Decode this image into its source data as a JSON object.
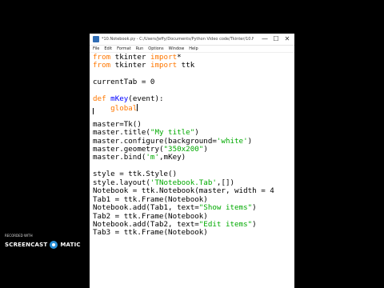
{
  "window": {
    "title": "*10.Notebook.py - C:/Users/Jeffy/Documents/Python Video code/Tkinter/10.Notebook.py (3.6...",
    "controls": {
      "minimize": "—",
      "maximize": "☐",
      "close": "✕"
    }
  },
  "menu": [
    "File",
    "Edit",
    "Format",
    "Run",
    "Options",
    "Window",
    "Help"
  ],
  "code": [
    [
      {
        "t": "from",
        "c": "kw"
      },
      {
        "t": " tkinter "
      },
      {
        "t": "import",
        "c": "kw"
      },
      {
        "t": "*"
      }
    ],
    [
      {
        "t": "from",
        "c": "kw"
      },
      {
        "t": " tkinter "
      },
      {
        "t": "import",
        "c": "kw"
      },
      {
        "t": " ttk"
      }
    ],
    [],
    [
      {
        "t": "currentTab = 0"
      }
    ],
    [],
    [
      {
        "t": "def",
        "c": "kw"
      },
      {
        "t": " "
      },
      {
        "t": "mKey",
        "c": "func"
      },
      {
        "t": "(event):"
      }
    ],
    [
      {
        "t": "    "
      },
      {
        "t": "global",
        "c": "kw"
      },
      {
        "caret": true
      }
    ],
    [],
    [
      {
        "t": "master=Tk()"
      }
    ],
    [
      {
        "t": "master.title("
      },
      {
        "t": "\"My title\"",
        "c": "str"
      },
      {
        "t": ")"
      }
    ],
    [
      {
        "t": "master.configure(background="
      },
      {
        "t": "'white'",
        "c": "str"
      },
      {
        "t": ")"
      }
    ],
    [
      {
        "t": "master.geometry("
      },
      {
        "t": "\"350x200\"",
        "c": "str"
      },
      {
        "t": ")"
      }
    ],
    [
      {
        "t": "master.bind("
      },
      {
        "t": "'m'",
        "c": "str"
      },
      {
        "t": ",mKey)"
      }
    ],
    [],
    [
      {
        "t": "style = ttk.Style()"
      }
    ],
    [
      {
        "t": "style.layout("
      },
      {
        "t": "'TNotebook.Tab'",
        "c": "str"
      },
      {
        "t": ",[])"
      }
    ],
    [
      {
        "t": "Notebook = ttk.Notebook(master, width = 4"
      }
    ],
    [
      {
        "t": "Tab1 = ttk.Frame(Notebook)"
      }
    ],
    [
      {
        "t": "Notebook.add(Tab1, text="
      },
      {
        "t": "\"Show items\"",
        "c": "str"
      },
      {
        "t": ")"
      }
    ],
    [
      {
        "t": "Tab2 = ttk.Frame(Notebook)"
      }
    ],
    [
      {
        "t": "Notebook.add(Tab2, text="
      },
      {
        "t": "\"Edit items\"",
        "c": "str"
      },
      {
        "t": ")"
      }
    ],
    [
      {
        "t": "Tab3 = ttk.Frame(Notebook)"
      }
    ]
  ],
  "watermark": {
    "recorded_with": "RECORDED WITH",
    "brand_left": "SCREENCAST",
    "brand_right": "MATIC"
  },
  "colors": {
    "keyword": "#ff7700",
    "string": "#00aa00",
    "function_name": "#0000ff",
    "background": "#000000",
    "editor_bg": "#ffffff"
  }
}
